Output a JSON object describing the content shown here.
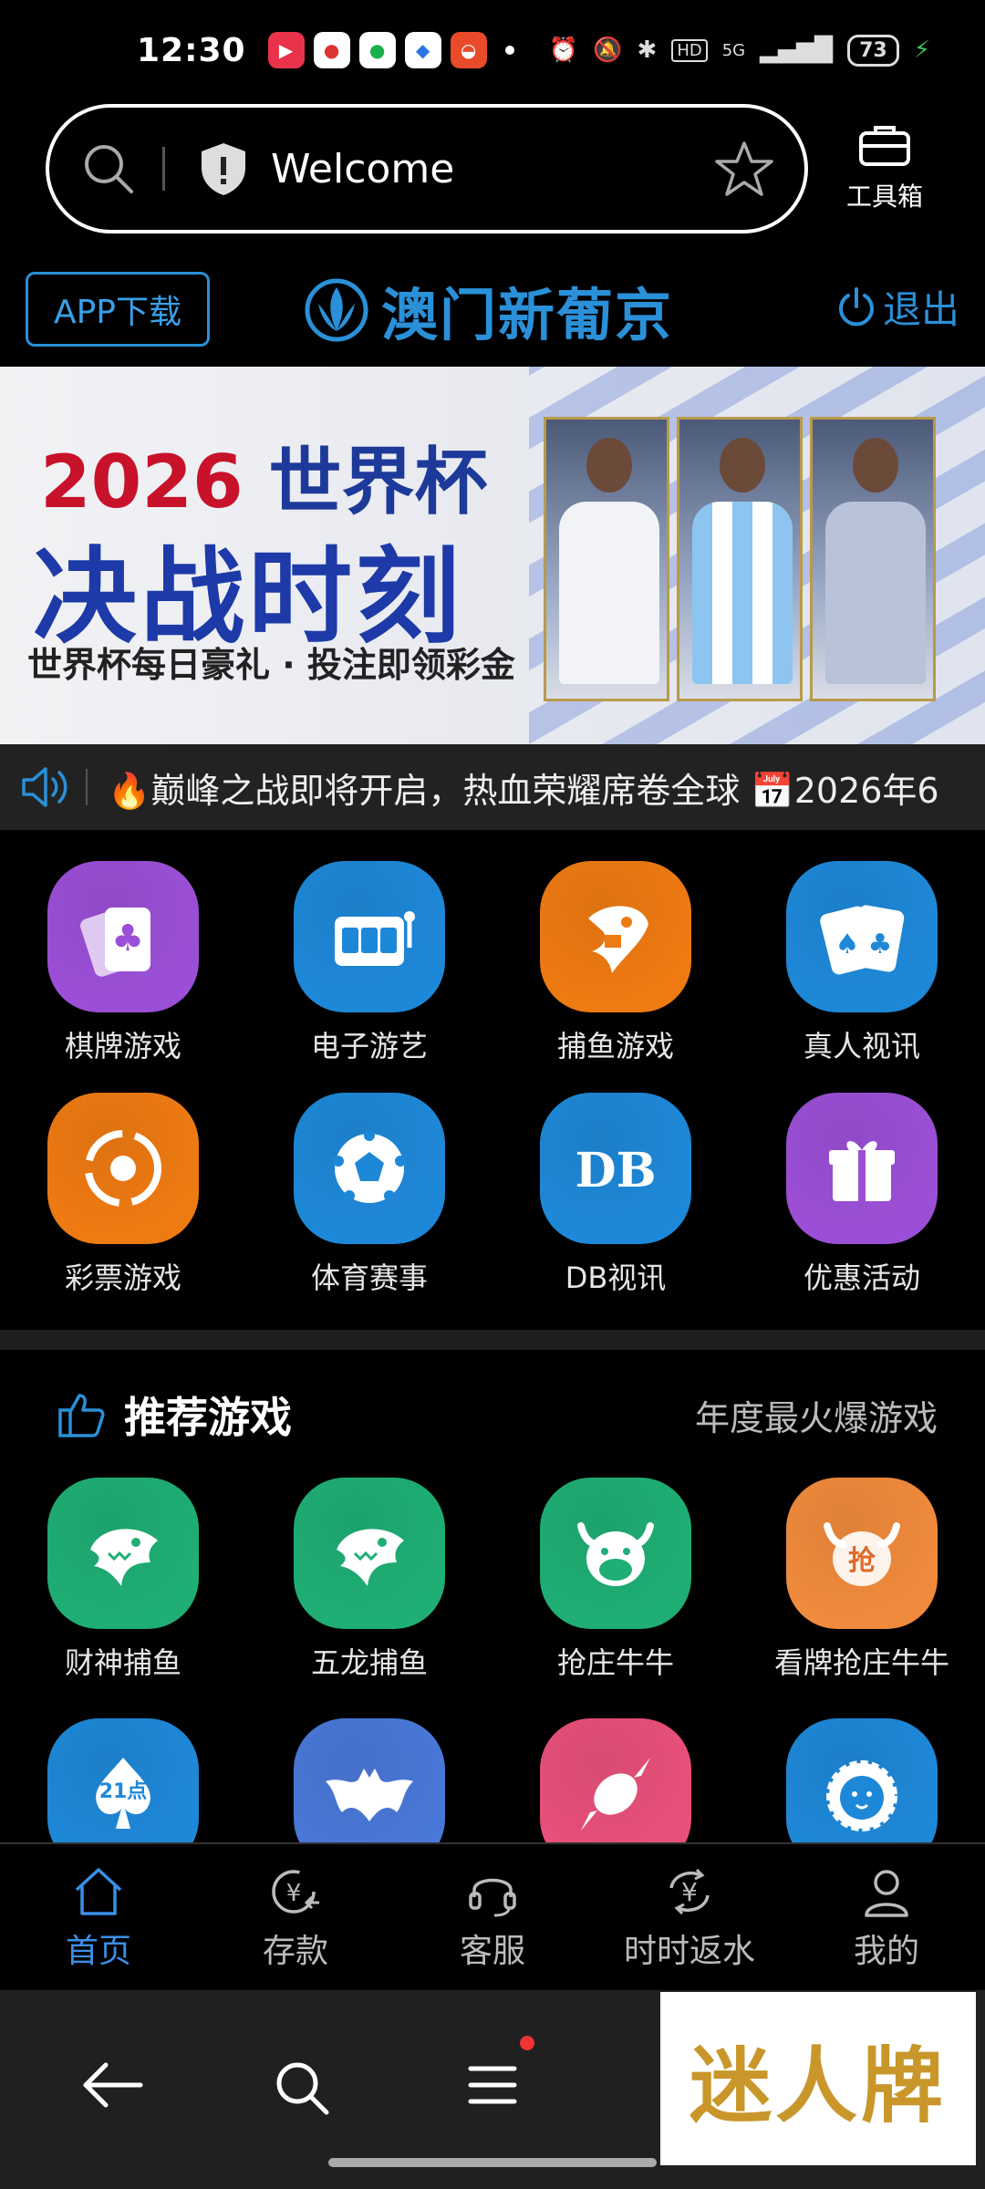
{
  "status_bar": {
    "time": "12:30",
    "network": "5G",
    "battery": "73",
    "notification_icons": [
      "video-app-icon",
      "maps-app-icon",
      "chat-app-icon",
      "browser-app-icon",
      "food-app-icon"
    ],
    "system_icons": [
      "alarm-icon",
      "mute-icon",
      "bluetooth-icon",
      "hd-icon",
      "signal-icon",
      "battery-icon",
      "charging-icon"
    ]
  },
  "browser": {
    "url_text": "Welcome",
    "toolbox_label": "工具箱"
  },
  "app_header": {
    "download_label": "APP下载",
    "brand": "澳门新葡京",
    "logout_label": "退出"
  },
  "banner": {
    "year": "2026",
    "line1_suffix": "世界杯",
    "line2": "决战时刻",
    "line3": "世界杯每日豪礼 · 投注即领彩金"
  },
  "marquee": {
    "text": "🔥巅峰之战即将开启，热血荣耀席卷全球 📅2026年6"
  },
  "categories": [
    {
      "label": "棋牌游戏",
      "icon": "cards-icon",
      "color": "#9b4fd6"
    },
    {
      "label": "电子游艺",
      "icon": "slot-machine-icon",
      "color": "#1e88d8"
    },
    {
      "label": "捕鱼游戏",
      "icon": "fish-icon",
      "color": "#ee7a12"
    },
    {
      "label": "真人视讯",
      "icon": "playing-cards-icon",
      "color": "#1e88d8"
    },
    {
      "label": "彩票游戏",
      "icon": "lottery-icon",
      "color": "#ee7a12"
    },
    {
      "label": "体育赛事",
      "icon": "soccer-ball-icon",
      "color": "#1e88d8"
    },
    {
      "label": "DB视讯",
      "icon": "db-logo-icon",
      "color": "#1e88d8"
    },
    {
      "label": "优惠活动",
      "icon": "gift-icon",
      "color": "#9b4fd6"
    }
  ],
  "recommended": {
    "title": "推荐游戏",
    "subtitle": "年度最火爆游戏",
    "games": [
      {
        "label": "财神捕鱼",
        "icon": "shark-icon",
        "color": "#1fae74"
      },
      {
        "label": "五龙捕鱼",
        "icon": "shark-icon",
        "color": "#1fae74"
      },
      {
        "label": "抢庄牛牛",
        "icon": "bull-icon",
        "color": "#1fae74"
      },
      {
        "label": "看牌抢庄牛牛",
        "icon": "bull-grab-icon",
        "color": "#f08a3c"
      }
    ],
    "games_row2": [
      {
        "label": "21点",
        "icon": "spade-icon",
        "color": "#1e88d8"
      },
      {
        "label": "",
        "icon": "bat-icon",
        "color": "#4a78d8"
      },
      {
        "label": "",
        "icon": "candy-icon",
        "color": "#e8507a"
      },
      {
        "label": "",
        "icon": "lion-icon",
        "color": "#1e88d8"
      }
    ]
  },
  "bottom_nav": [
    {
      "label": "首页",
      "icon": "home-icon",
      "active": true
    },
    {
      "label": "存款",
      "icon": "deposit-icon",
      "active": false
    },
    {
      "label": "客服",
      "icon": "headset-icon",
      "active": false
    },
    {
      "label": "时时返水",
      "icon": "rebate-icon",
      "active": false
    },
    {
      "label": "我的",
      "icon": "user-icon",
      "active": false
    }
  ],
  "watermark": "迷人牌",
  "colors": {
    "accent": "#2a90d8",
    "active_nav": "#3a8fe8"
  }
}
